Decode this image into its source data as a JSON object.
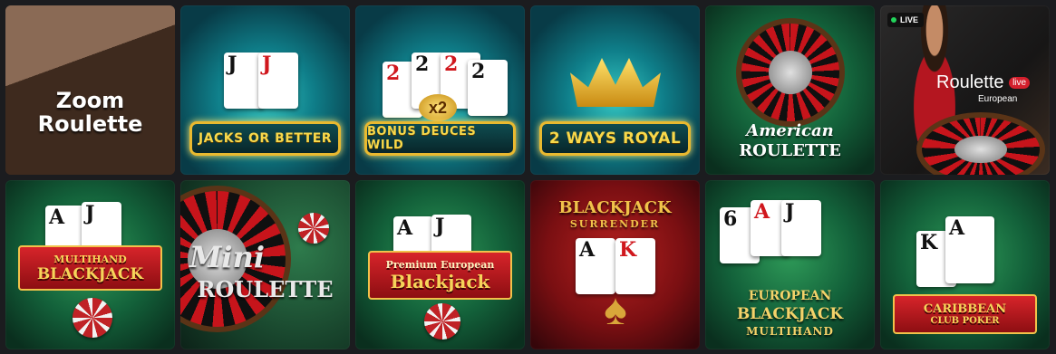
{
  "tiles": [
    {
      "title": "Zoom Roulette"
    },
    {
      "title": "JACKS OR BETTER",
      "cards": [
        "J",
        "J"
      ]
    },
    {
      "title": "BONUS DEUCES WILD",
      "cards": [
        "2",
        "2",
        "2",
        "2"
      ],
      "multiplier": "x2"
    },
    {
      "title": "2 WAYS ROYAL"
    },
    {
      "title_line1": "American",
      "title_line2": "ROULETTE"
    },
    {
      "badge": "LIVE",
      "title": "Roulette",
      "title_suffix": "live",
      "subtitle": "European"
    },
    {
      "title_line1": "MULTIHAND",
      "title_line2": "BLACKJACK",
      "cards": [
        "A",
        "J"
      ]
    },
    {
      "title_line1": "Mini",
      "title_line2": "ROULETTE"
    },
    {
      "title_line1": "Premium European",
      "title_line2": "Blackjack",
      "cards": [
        "A",
        "J"
      ]
    },
    {
      "title_line1": "BLACKJACK",
      "title_line2": "SURRENDER",
      "cards": [
        "A",
        "K"
      ]
    },
    {
      "title_line1": "EUROPEAN",
      "title_line2": "BLACKJACK",
      "title_line3": "MULTIHAND",
      "cards": [
        "6",
        "A",
        "J"
      ]
    },
    {
      "title_line1": "CARIBBEAN",
      "title_line2": "CLUB POKER",
      "cards": [
        "K",
        "A"
      ]
    }
  ]
}
